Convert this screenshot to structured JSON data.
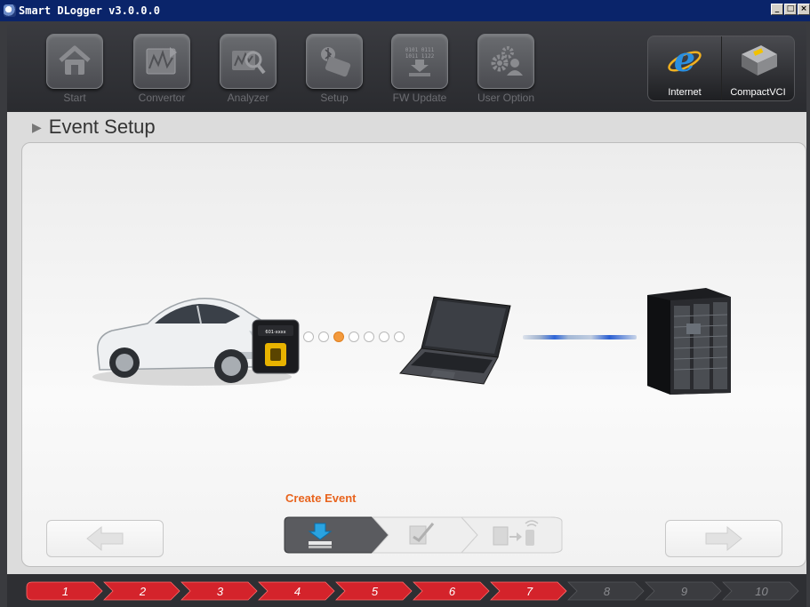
{
  "window": {
    "title": "Smart DLogger v3.0.0.0",
    "buttons": [
      "minimize",
      "maximize",
      "close"
    ]
  },
  "toolbar": {
    "items": [
      {
        "label": "Start",
        "icon": "home-icon"
      },
      {
        "label": "Convertor",
        "icon": "chart-convert-icon"
      },
      {
        "label": "Analyzer",
        "icon": "magnifier-chart-icon"
      },
      {
        "label": "Setup",
        "icon": "device-bluetooth-icon"
      },
      {
        "label": "FW Update",
        "icon": "binary-download-icon"
      },
      {
        "label": "User Option",
        "icon": "user-gear-icon"
      }
    ],
    "right": [
      {
        "label": "Internet",
        "icon": "internet-explorer-icon"
      },
      {
        "label": "CompactVCI",
        "icon": "vci-device-icon"
      }
    ]
  },
  "section": {
    "title": "Event Setup"
  },
  "diagram": {
    "device_label": "601-xxxx",
    "progress_dots": 7,
    "active_dot": 3
  },
  "wizard": {
    "current_step_label": "Create Event",
    "steps": [
      "create-event",
      "edit-event",
      "transfer-event"
    ],
    "active_step": 1
  },
  "progress_steps": {
    "labels": [
      "1",
      "2",
      "3",
      "4",
      "5",
      "6",
      "7",
      "8",
      "9",
      "10"
    ],
    "completed": 7
  },
  "colors": {
    "accent_orange": "#e8641e",
    "step_red": "#d4232b",
    "step_dark": "#3b3c40",
    "frame_dark": "#2e2f33"
  }
}
